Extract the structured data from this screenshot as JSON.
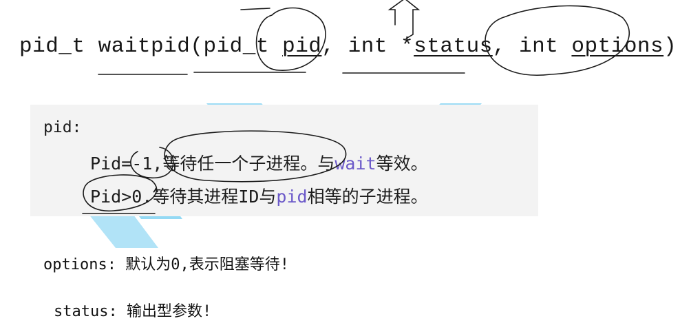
{
  "signature": {
    "return_type": "pid_t",
    "func_name": "waitpid",
    "open_paren": "(",
    "p1_type": "pid_t",
    "p1_name": "pid",
    "comma1": ",",
    "p2_type": "int",
    "p2_star": "*",
    "p2_name": "status",
    "comma2": ",",
    "p3_type": "int",
    "p3_name": "options",
    "close": ");"
  },
  "pid_note": {
    "title": "pid:",
    "line1_prefix": "Pid=-1,",
    "line1_text": "等待任一个子进程。与",
    "line1_kw": "wait",
    "line1_suffix": "等效。",
    "line2_prefix": "Pid>0.",
    "line2_text": "等待其进程ID与",
    "line2_kw": "pid",
    "line2_suffix": "相等的子进程。"
  },
  "options_line": "options: 默认为0,表示阻塞等待!",
  "status_line": "status: 输出型参数!",
  "colors": {
    "keyword": "#6b59c9",
    "watermark": "#38b8ea",
    "note_bg": "#f3f3f3"
  }
}
